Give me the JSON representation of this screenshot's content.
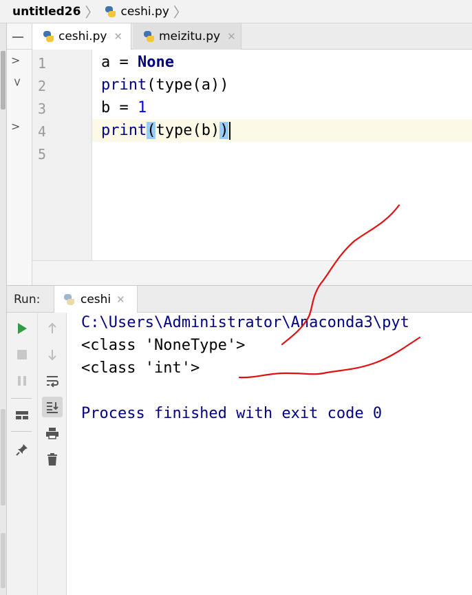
{
  "breadcrumb": {
    "project": "untitled26",
    "file": "ceshi.py"
  },
  "editor": {
    "tabs": [
      {
        "label": "ceshi.py",
        "active": true
      },
      {
        "label": "meizitu.py",
        "active": false
      }
    ],
    "line_numbers": [
      "1",
      "2",
      "3",
      "4",
      "5"
    ],
    "current_line": 4,
    "code": {
      "line1": {
        "lhs": "a = ",
        "kw": "None"
      },
      "line2": {
        "fn": "print",
        "rest": "(type(a))"
      },
      "line3": {
        "lhs": "b = ",
        "num": "1"
      },
      "line4": {
        "fn": "print",
        "open": "(",
        "mid": "type(b)",
        "close": ")"
      }
    }
  },
  "run": {
    "label": "Run:",
    "tab": "ceshi",
    "output": {
      "cmd": "C:\\Users\\Administrator\\Anaconda3\\pyt",
      "line1": "<class 'NoneType'>",
      "line2": "<class 'int'>",
      "exit": "Process finished with exit code 0"
    },
    "colors": {
      "command": "#000080",
      "stdout": "#000000",
      "run_green": "#2e9e3e"
    }
  },
  "annotation": {
    "ink_color": "#e01010"
  }
}
